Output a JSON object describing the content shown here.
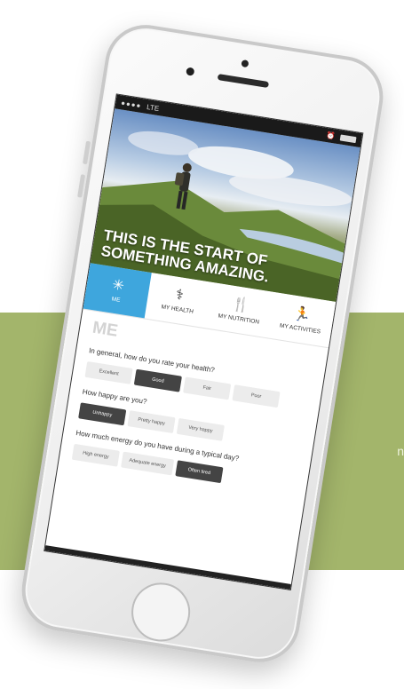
{
  "status": {
    "signal": "●●●●",
    "carrier": "LTE"
  },
  "hero": {
    "headline_line1": "THIS IS THE START OF",
    "headline_line2": "SOMETHING AMAZING."
  },
  "tabs": [
    {
      "label": "ME",
      "icon": "vitruvian-icon"
    },
    {
      "label": "MY HEALTH",
      "icon": "caduceus-icon"
    },
    {
      "label": "MY NUTRITION",
      "icon": "fork-knife-icon"
    },
    {
      "label": "MY ACTIVITIES",
      "icon": "runner-icon"
    }
  ],
  "section": {
    "title": "ME"
  },
  "questions": [
    {
      "text": "In general, how do you rate your health?",
      "options": [
        "Excellent",
        "Good",
        "Fair",
        "Poor"
      ],
      "selected": "Good"
    },
    {
      "text": "How happy are you?",
      "options": [
        "Unhappy",
        "Pretty happy",
        "Very happy"
      ],
      "selected": "Unhappy"
    },
    {
      "text": "How much energy do you have during a typical day?",
      "options": [
        "High energy",
        "Adequate energy",
        "Often tired"
      ],
      "selected": "Often tired"
    }
  ],
  "background": {
    "band_char": "n",
    "band_color": "#a3b56b",
    "accent": "#3ea6dd"
  }
}
